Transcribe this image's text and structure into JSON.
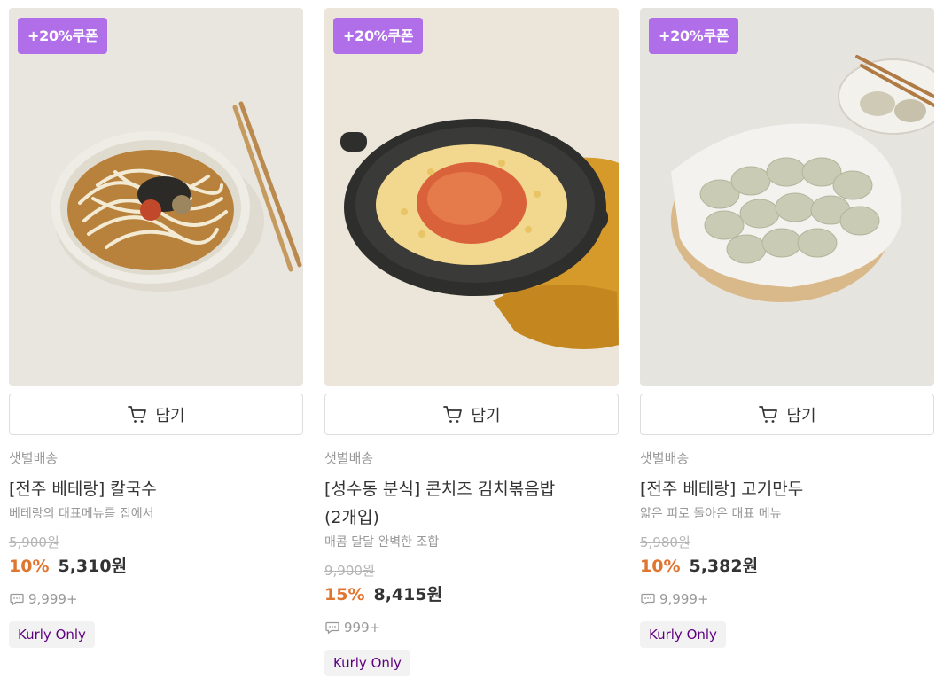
{
  "products": [
    {
      "coupon": "+20%쿠폰",
      "cart_label": "담기",
      "delivery": "샛별배송",
      "name": "[전주 베테랑] 칼국수",
      "description": "베테랑의 대표메뉴를 집에서",
      "original_price": "5,900원",
      "discount_rate": "10%",
      "price": "5,310원",
      "reviews": "9,999+",
      "tag": "Kurly Only",
      "image_icon": "noodle-soup-photo"
    },
    {
      "coupon": "+20%쿠폰",
      "cart_label": "담기",
      "delivery": "샛별배송",
      "name": "[성수동 분식] 콘치즈 김치볶음밥(2개입)",
      "description": "매콤 달달 완벽한 조합",
      "original_price": "9,900원",
      "discount_rate": "15%",
      "price": "8,415원",
      "reviews": "999+",
      "tag": "Kurly Only",
      "image_icon": "kimchi-fried-rice-photo"
    },
    {
      "coupon": "+20%쿠폰",
      "cart_label": "담기",
      "delivery": "샛별배송",
      "name": "[전주 베테랑] 고기만두",
      "description": "얇은 피로 돌아온 대표 메뉴",
      "original_price": "5,980원",
      "discount_rate": "10%",
      "price": "5,382원",
      "reviews": "9,999+",
      "tag": "Kurly Only",
      "image_icon": "dumplings-photo"
    }
  ],
  "colors": {
    "coupon_bg": "#b06ee8",
    "discount": "#e0752f",
    "tag_text": "#5f0080"
  }
}
